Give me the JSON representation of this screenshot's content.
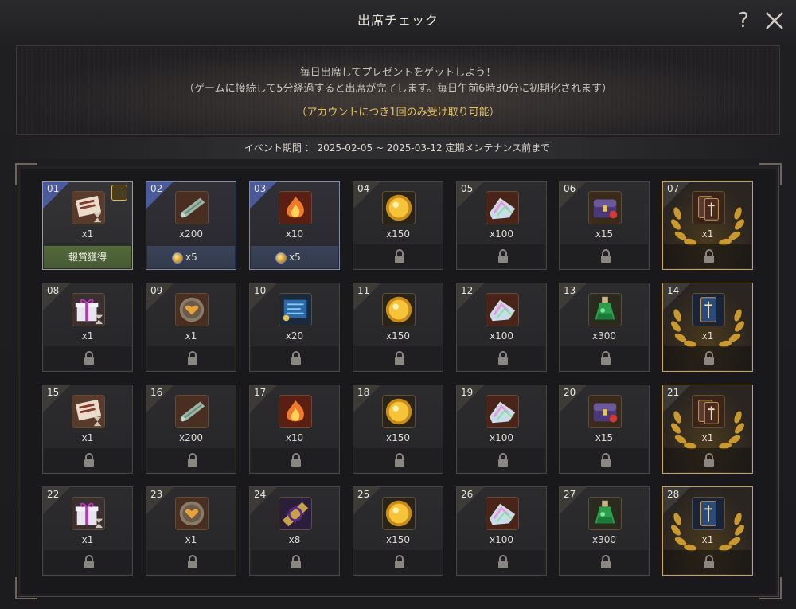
{
  "window": {
    "title": "出席チェック"
  },
  "banner": {
    "line1": "毎日出席してプレゼントをゲットしよう！",
    "line2": "（ゲームに接続して5分経過すると出席が完了します。毎日午前6時30分に初期化されます）",
    "note": "（アカウントにつき1回のみ受け取り可能）"
  },
  "period": "イベント期間 ： 2025-02-05 ~ 2025-03-12 定期メンテナンス前まで",
  "labels": {
    "help": "?",
    "claimed": "報賞獲得"
  },
  "colors": {
    "accent_gold": "#e8c25a",
    "claimed_green": "#546a3c",
    "active_blue": "#4b5a9a",
    "special_border": "#c9a15b"
  },
  "days": [
    {
      "day": "01",
      "item": "ticket",
      "qty": "x1",
      "state": "claimed",
      "badge": "gift"
    },
    {
      "day": "02",
      "item": "scroll",
      "qty": "x200",
      "state": "active",
      "bonus": "x5"
    },
    {
      "day": "03",
      "item": "fire",
      "qty": "x10",
      "state": "active",
      "bonus": "x5"
    },
    {
      "day": "04",
      "item": "gold-orb",
      "qty": "x150",
      "state": "locked"
    },
    {
      "day": "05",
      "item": "crystals",
      "qty": "x100",
      "state": "locked"
    },
    {
      "day": "06",
      "item": "chest",
      "qty": "x15",
      "state": "locked"
    },
    {
      "day": "07",
      "item": "card",
      "qty": "x1",
      "state": "locked",
      "special": true
    },
    {
      "day": "08",
      "item": "gift-box",
      "qty": "x1",
      "state": "locked"
    },
    {
      "day": "09",
      "item": "coin-heart",
      "qty": "x1",
      "state": "locked"
    },
    {
      "day": "10",
      "item": "blue-scroll",
      "qty": "x20",
      "state": "locked"
    },
    {
      "day": "11",
      "item": "gold-orb",
      "qty": "x150",
      "state": "locked"
    },
    {
      "day": "12",
      "item": "crystals",
      "qty": "x100",
      "state": "locked"
    },
    {
      "day": "13",
      "item": "potion",
      "qty": "x300",
      "state": "locked"
    },
    {
      "day": "14",
      "item": "card-blue",
      "qty": "x1",
      "state": "locked",
      "special": true
    },
    {
      "day": "15",
      "item": "ticket",
      "qty": "x1",
      "state": "locked"
    },
    {
      "day": "16",
      "item": "scroll",
      "qty": "x200",
      "state": "locked"
    },
    {
      "day": "17",
      "item": "fire",
      "qty": "x10",
      "state": "locked"
    },
    {
      "day": "18",
      "item": "gold-orb",
      "qty": "x150",
      "state": "locked"
    },
    {
      "day": "19",
      "item": "crystals",
      "qty": "x100",
      "state": "locked"
    },
    {
      "day": "20",
      "item": "chest",
      "qty": "x15",
      "state": "locked"
    },
    {
      "day": "21",
      "item": "card",
      "qty": "x1",
      "state": "locked",
      "special": true
    },
    {
      "day": "22",
      "item": "gift-box",
      "qty": "x1",
      "state": "locked"
    },
    {
      "day": "23",
      "item": "coin-heart",
      "qty": "x1",
      "state": "locked"
    },
    {
      "day": "24",
      "item": "sun-scroll",
      "qty": "x8",
      "state": "locked"
    },
    {
      "day": "25",
      "item": "gold-orb",
      "qty": "x150",
      "state": "locked"
    },
    {
      "day": "26",
      "item": "crystals",
      "qty": "x100",
      "state": "locked"
    },
    {
      "day": "27",
      "item": "potion",
      "qty": "x300",
      "state": "locked"
    },
    {
      "day": "28",
      "item": "card-blue",
      "qty": "x1",
      "state": "locked",
      "special": true
    }
  ]
}
